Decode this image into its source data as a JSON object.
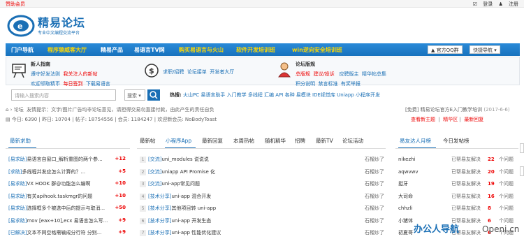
{
  "topbar": {
    "sponsor": "赞助会员",
    "login": "登录",
    "register": "注册"
  },
  "logo": {
    "title": "精易论坛",
    "subtitle": "专业中文编程交流平台"
  },
  "nav": {
    "items": [
      "门户导航",
      "程序猿威客大厅",
      "精易产品",
      "易语言TV网",
      "购买易语言与火山",
      "软件开发培训班",
      "win逆向安全培训班"
    ],
    "official_qq": "官方QQ群",
    "quick_nav": "快捷导航"
  },
  "info": {
    "newbie": {
      "title": "新人指南",
      "l1a": "遵守好发法则",
      "l1b": "我关注人的新帖",
      "l2a": "欢迎领取精币",
      "l2b": "每日签到",
      "l2c": "下载易语言"
    },
    "jobs": {
      "a": "求职/招聘",
      "b": "论坛接单",
      "c": "开发者大厅"
    },
    "forum": {
      "title": "论坛版规",
      "l1a": "总版规",
      "l1b": "建议/投诉",
      "l1c": "应聘版主",
      "l1d": "精华帖总集",
      "l2a": "积分说明",
      "l2b": "禁言标准",
      "l2c": "有奖举报"
    }
  },
  "search": {
    "placeholder": "请输入搜索内容",
    "type": "搜索",
    "hot_label": "热搜:",
    "hot": "火山PC  易语言助手  入门教学  多线程  汇编  API  各种  易模块  IDE视觉库  Uniapp  小程序开发"
  },
  "bread": {
    "home": "论坛",
    "notice": "友情提示：文字/图片广告均非论坛意见，请担得交易勿直接付款，由此产生的责任自负",
    "right": "[免费] 精易论坛官方E入门教学培训",
    "date": "(2017-6-6)"
  },
  "stats": {
    "text": "今日: 6390 | 昨日: 10704 | 帖子: 18754556 | 会员: 1184247 | 欢迎新会员: NoBodyToast",
    "links": [
      "查看新主题",
      "精华区",
      "最新回复"
    ]
  },
  "left_tab": "最新求助",
  "middle_tabs": [
    "最新帖",
    "小程序App",
    "最新回复",
    "本周热帖",
    "随机精华",
    "招聘",
    "最新TV",
    "论坛活动"
  ],
  "right_tabs": [
    "易友达人月榜",
    "今日发帖榜"
  ],
  "left_rows": [
    {
      "tag": "[易求助]",
      "text": "易语言自窗口_解析重图的两个参...",
      "score": "+12"
    },
    {
      "tag": "[求助]",
      "text": "多线程并发应怎么计算的？...",
      "score": "+5"
    },
    {
      "tag": "[易求助]",
      "text": "VX HOOK 群@功能怎么编啊",
      "score": "+10"
    },
    {
      "tag": "[易求助]",
      "text": "有关apihook.taskmgr的问题",
      "score": "+10"
    },
    {
      "tag": "[易求助]",
      "text": "选择框多个被选中后的提示与取消...",
      "score": "+50"
    },
    {
      "tag": "[易求助]",
      "text": "mov [eax+10],ecx 易语言怎么写...",
      "score": "+9"
    },
    {
      "tag": "[已解决]",
      "text": "文本不同空格需输成分行符 分别...",
      "score": "+9"
    }
  ],
  "middle_rows": [
    {
      "n": "1",
      "tag": "[交流]",
      "text": "uni_modules 说说说",
      "user": "石榴炒了"
    },
    {
      "n": "2",
      "tag": "[交流]",
      "text": "uniapp API Promise 化",
      "user": "石榴炒了"
    },
    {
      "n": "3",
      "tag": "[交流]",
      "text": "uni-app常见问题",
      "user": "石榴炒了"
    },
    {
      "n": "4",
      "tag": "[技术分享]",
      "text": "uni-app 混合开发",
      "user": "石榴炒了"
    },
    {
      "n": "5",
      "tag": "[技术分享]",
      "text": "其他项目转 uni-app",
      "user": "石榴炒了"
    },
    {
      "n": "6",
      "tag": "[技术分享]",
      "text": "uni-app 开发生态",
      "user": "石榴炒了"
    },
    {
      "n": "7",
      "tag": "[技术分享]",
      "text": "uni-app 性能优化建议",
      "user": "石榴炒了"
    }
  ],
  "right_rows": [
    {
      "name": "nikezhi",
      "desc": "已帮易友解决",
      "num": "22",
      "unit": "个问题"
    },
    {
      "name": "aqwvwv",
      "desc": "已帮易友解决",
      "num": "20",
      "unit": "个问题"
    },
    {
      "name": "挺牙",
      "desc": "已帮易友解决",
      "num": "19",
      "unit": "个问题"
    },
    {
      "name": "大司命",
      "desc": "已帮易友解决",
      "num": "16",
      "unit": "个问题"
    },
    {
      "name": "chhzli",
      "desc": "已帮易友解决",
      "num": "8",
      "unit": "个问题"
    },
    {
      "name": "小猪体",
      "desc": "已帮易友解决",
      "num": "6",
      "unit": "个问题"
    },
    {
      "name": "初夏哥",
      "desc": "已帮易友解决",
      "num": "6",
      "unit": "个问题"
    }
  ],
  "watermark": {
    "a": "办公人导航",
    "b": "Openi.cn"
  }
}
